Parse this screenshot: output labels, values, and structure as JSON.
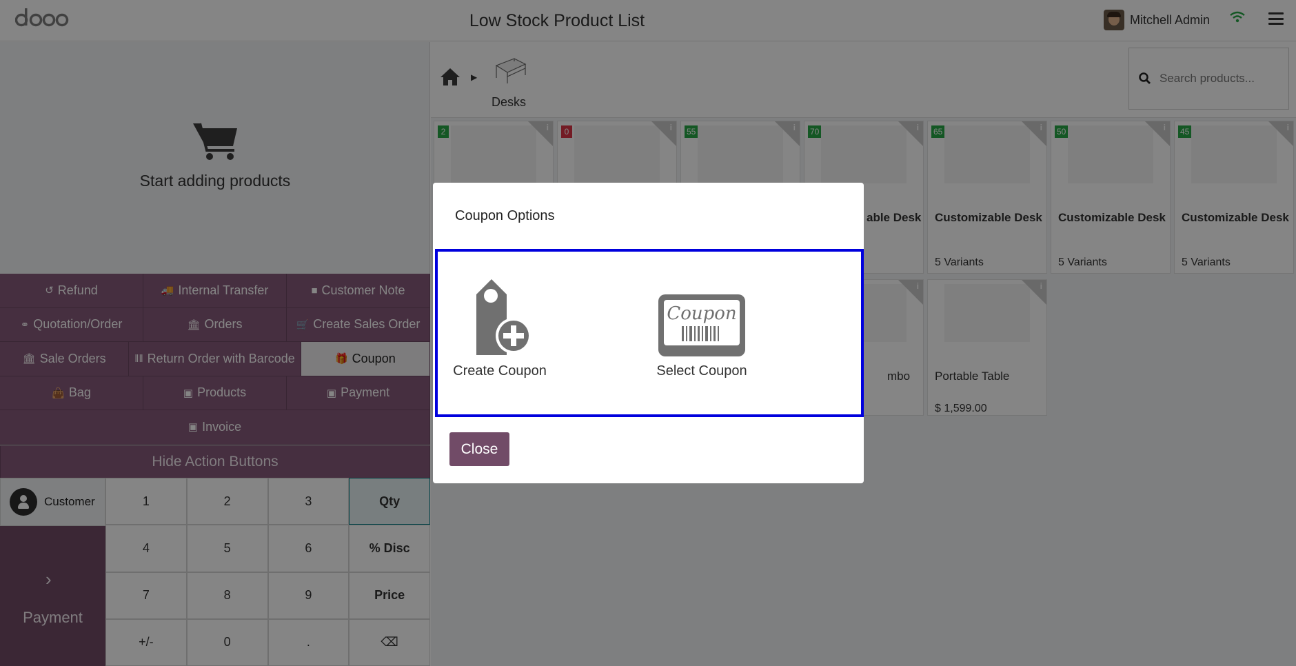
{
  "header": {
    "logo_text": "odoo",
    "title": "Low Stock Product List",
    "user_name": "Mitchell Admin",
    "wifi_icon": "wifi-icon",
    "menu_icon": "hamburger-menu-icon"
  },
  "cart": {
    "empty_text": "Start adding products",
    "icon": "cart-icon"
  },
  "actions": {
    "rows": [
      [
        {
          "label": "Refund",
          "icon": "undo-icon"
        },
        {
          "label": "Internal Transfer",
          "icon": "truck-icon"
        },
        {
          "label": "Customer Note",
          "icon": "note-icon"
        }
      ],
      [
        {
          "label": "Quotation/Order",
          "icon": "link-icon"
        },
        {
          "label": "Orders",
          "icon": "bank-icon"
        },
        {
          "label": "Create Sales Order",
          "icon": "cart-icon"
        }
      ],
      [
        {
          "label": "Sale Orders",
          "icon": "bank-icon"
        },
        {
          "label": "Return Order with Barcode",
          "icon": "barcode-icon"
        },
        {
          "label": "Coupon",
          "icon": "gift-icon"
        }
      ],
      [
        {
          "label": "Bag",
          "icon": "bag-icon"
        },
        {
          "label": "Products",
          "icon": "money-icon"
        },
        {
          "label": "Payment",
          "icon": "money-icon"
        }
      ],
      [
        {
          "label": "Invoice",
          "icon": "money-icon"
        }
      ]
    ],
    "hide_label": "Hide Action Buttons"
  },
  "numpad": {
    "customer_label": "Customer",
    "payment_label": "Payment",
    "keys": [
      "1",
      "2",
      "3",
      "Qty",
      "4",
      "5",
      "6",
      "% Disc",
      "7",
      "8",
      "9",
      "Price",
      "+/-",
      "0",
      ".",
      "⌫"
    ]
  },
  "breadcrumb": {
    "category": "Desks",
    "home_icon": "home-icon"
  },
  "search": {
    "placeholder": "Search products..."
  },
  "products": [
    {
      "badge": "2",
      "badge_color": "#28a745",
      "name": "",
      "sub": ""
    },
    {
      "badge": "0",
      "badge_color": "#dc3545",
      "name": "",
      "sub": ""
    },
    {
      "badge": "55",
      "badge_color": "#28a745",
      "name": "",
      "sub": ""
    },
    {
      "badge": "70",
      "badge_color": "#28a745",
      "name": "able Desk",
      "sub": ""
    },
    {
      "badge": "65",
      "badge_color": "#28a745",
      "name": "Customizable Desk",
      "sub": "5 Variants"
    },
    {
      "badge": "50",
      "badge_color": "#28a745",
      "name": "Customizable Desk",
      "sub": "5 Variants"
    },
    {
      "badge": "45",
      "badge_color": "#28a745",
      "name": "Customizable Desk",
      "sub": "5 Variants"
    },
    {
      "badge": "",
      "name": "mbo",
      "sub": ""
    },
    {
      "badge": "",
      "name": "Portable Table",
      "sub": "$ 1,599.00"
    }
  ],
  "modal": {
    "title": "Coupon Options",
    "create_label": "Create Coupon",
    "select_label": "Select Coupon",
    "coupon_word": "Coupon",
    "close_label": "Close"
  },
  "colors": {
    "accent": "#714b67",
    "action_bg": "#875a7b",
    "focus_outline": "#0000dd",
    "badge_green": "#28a745",
    "badge_red": "#dc3545"
  }
}
